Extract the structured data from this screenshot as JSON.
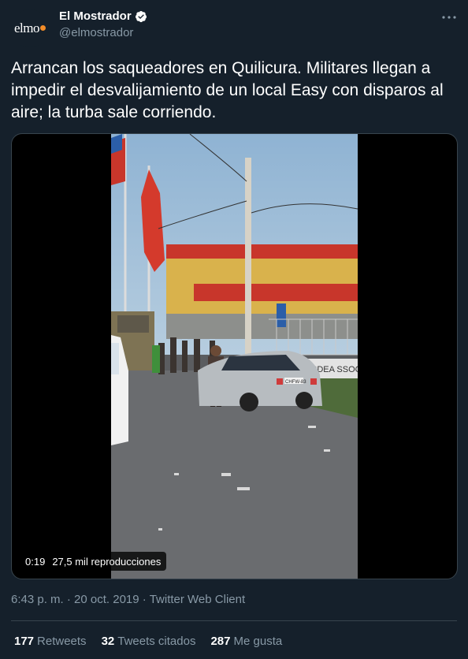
{
  "account": {
    "avatar_text": "elmo",
    "display_name": "El Mostrador",
    "handle": "@elmostrador",
    "verified": true
  },
  "tweet": {
    "text": "Arrancan los saqueadores en Quilicura. Militares llegan a impedir el desvalijamiento de un local Easy con disparos al aire; la turba sale corriendo."
  },
  "video": {
    "duration": "0:19",
    "views": "27,5 mil reproducciones",
    "scene": {
      "vehicle_plate": "CHFW-83",
      "wall_text": "SDEA SSOCA"
    }
  },
  "meta": {
    "time": "6:43 p. m.",
    "date": "20 oct. 2019",
    "source": "Twitter Web Client"
  },
  "stats": {
    "retweets_count": "177",
    "retweets_label": "Retweets",
    "quotes_count": "32",
    "quotes_label": "Tweets citados",
    "likes_count": "287",
    "likes_label": "Me gusta"
  },
  "colors": {
    "background": "#15202b",
    "secondary_text": "#8899a6",
    "border": "#38444d",
    "verified_badge": "#ffffff",
    "avatar_dot": "#f28c28"
  },
  "icons": {
    "more": "more-icon",
    "verified": "verified-badge-icon"
  }
}
